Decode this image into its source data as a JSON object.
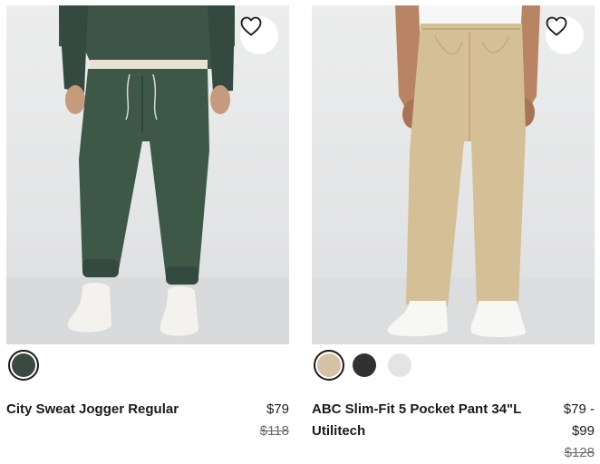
{
  "products": [
    {
      "title": "City Sweat Jogger Regular",
      "price": "$79",
      "original_price": "$118",
      "image_alt": "green jogger",
      "swatches": [
        {
          "color": "#3a4a40",
          "selected": true
        }
      ]
    },
    {
      "title": "ABC Slim-Fit 5 Pocket Pant 34\"L Utilitech",
      "price_from": "$79 -",
      "price_to": "$99",
      "original_price": "$128",
      "swatches": [
        {
          "color": "#d6c3a3",
          "selected": true
        },
        {
          "color": "#2f3133",
          "selected": false
        },
        {
          "color": "#e4e4e6",
          "selected": false
        }
      ]
    }
  ],
  "icons": {
    "wishlist": "heart-outline-icon"
  },
  "colors": {
    "text": "#1a1a1a",
    "muted_price": "#6b6b6b",
    "wishlist_bg": "#ffffff"
  }
}
